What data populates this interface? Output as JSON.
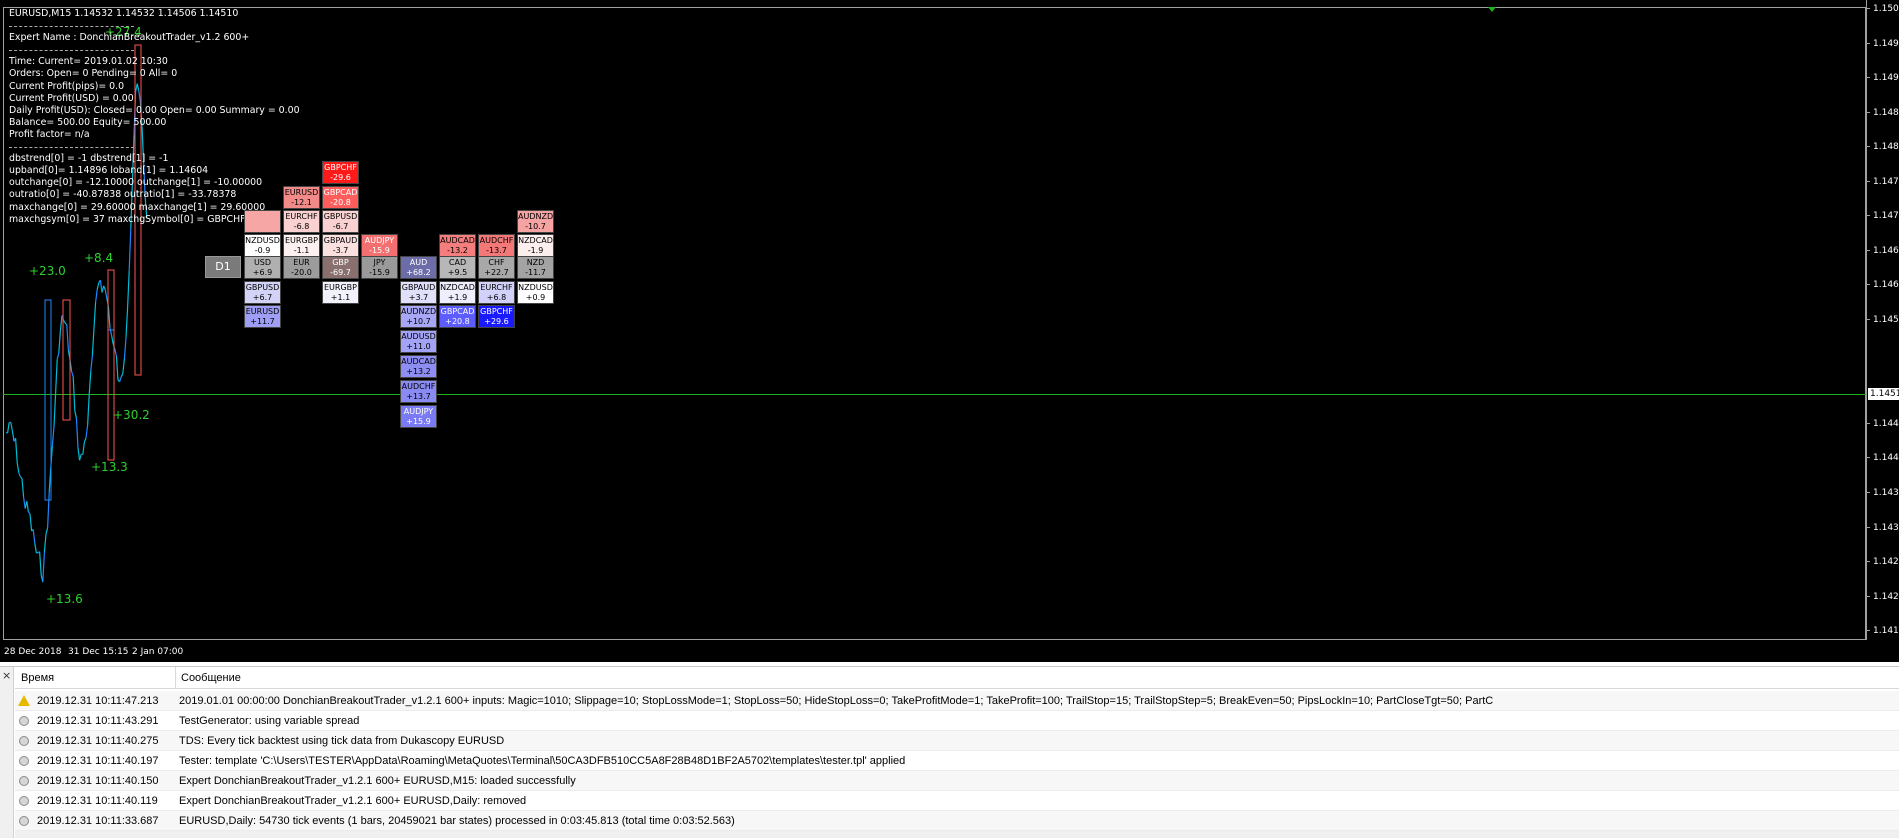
{
  "chart": {
    "symbol_header": "EURUSD,M15  1.14532 1.14532 1.14506 1.14510",
    "current_price": "1.1451",
    "price_labels": [
      "1.1500",
      "1.1495",
      "1.1490",
      "1.1485",
      "1.1480",
      "1.1475",
      "1.1470",
      "1.1465",
      "1.1460",
      "1.1455",
      "1.1445",
      "1.1440",
      "1.1435",
      "1.1430",
      "1.1425",
      "1.1420",
      "1.1415"
    ],
    "time_labels": [
      "28 Dec 2018",
      "31 Dec 15:15",
      "2 Jan 07:00"
    ],
    "signal_labels": [
      "+27.4",
      "+23.0",
      "+8.4",
      "+30.2",
      "+13.3",
      "+13.6"
    ],
    "colors": {
      "background": "#000000",
      "bull_candle": "#1e88ff",
      "bear_candle": "#00bcd4",
      "price_line": "#1db31d",
      "signal_text": "#2ed12e"
    }
  },
  "info_panel": {
    "expert_name": "Expert Name : DonchianBreakoutTrader_v1.2 600+",
    "time": "Time: Current= 2019.01.02 10:30",
    "orders": "Orders: Open= 0 Pending= 0 All= 0",
    "profit_pips": "Current Profit(pips)= 0.0",
    "profit_usd": "Current Profit(USD) = 0.00",
    "daily_profit": "Daily Profit(USD): Closed= 0.00 Open= 0.00 Summary = 0.00",
    "balance": "Balance= 500.00 Equity= 500.00",
    "profit_factor": "Profit factor= n/a",
    "dbstrend": "dbstrend[0] = -1 dbstrend[1] = -1",
    "upband": "upband[0]= 1.14896 loband[1] = 1.14604",
    "outchange": "outchange[0] = -12.10000 outchange[1] = -10.00000",
    "outratio": "outratio[0] = -40.87838 outratio[1] = -33.78378",
    "maxchange": "maxchange[0] = 29.60000 maxchange[1] = 29.60000",
    "maxchgsym": "maxchgsym[0] = 37 maxchgSymbol[0] = GBPCHF"
  },
  "heatmap": {
    "timeframe_button": "D1",
    "cells": [
      {
        "id": "gbpchf-top",
        "name": "GBPCHF",
        "value": "-29.6",
        "color": "#ff1a1a",
        "light": true
      },
      {
        "id": "eurusd-top",
        "name": "EURUSD",
        "value": "-12.1",
        "color": "#f28a8a",
        "light": false
      },
      {
        "id": "gbpcad-top",
        "name": "GBPCAD",
        "value": "-20.8",
        "color": "#ff5c5c",
        "light": true
      },
      {
        "id": "usd-empty",
        "name": "",
        "value": "",
        "color": "#f7a6a6",
        "light": false
      },
      {
        "id": "eurchf-top",
        "name": "EURCHF",
        "value": "-6.8",
        "color": "#f9d1d1",
        "light": false
      },
      {
        "id": "gbpusd-top",
        "name": "GBPUSD",
        "value": "-6.7",
        "color": "#f9d1d1",
        "light": false
      },
      {
        "id": "audnzd-top",
        "name": "AUDNZD",
        "value": "-10.7",
        "color": "#f6a3a3",
        "light": false
      },
      {
        "id": "nzdusd",
        "name": "NZDUSD",
        "value": "-0.9",
        "color": "#ffffff",
        "light": false
      },
      {
        "id": "eurgbp-top",
        "name": "EURGBP",
        "value": "-1.1",
        "color": "#fdf0f0",
        "light": false
      },
      {
        "id": "gbpaud-top",
        "name": "GBPAUD",
        "value": "-3.7",
        "color": "#fbe0e0",
        "light": false
      },
      {
        "id": "audjpy-top",
        "name": "AUDJPY",
        "value": "-15.9",
        "color": "#f47070",
        "light": true
      },
      {
        "id": "audcad-top",
        "name": "AUDCAD",
        "value": "-13.2",
        "color": "#f47d7d",
        "light": false
      },
      {
        "id": "audchf-top",
        "name": "AUDCHF",
        "value": "-13.7",
        "color": "#f47878",
        "light": false
      },
      {
        "id": "nzdcad-top",
        "name": "NZDCAD",
        "value": "-1.9",
        "color": "#fdeeee",
        "light": false
      },
      {
        "id": "usd",
        "name": "USD",
        "value": "+6.9",
        "color": "#b0b0b0",
        "light": false
      },
      {
        "id": "eur",
        "name": "EUR",
        "value": "-20.0",
        "color": "#9c9c9c",
        "light": false
      },
      {
        "id": "gbp",
        "name": "GBP",
        "value": "-69.7",
        "color": "#8a6f6f",
        "light": true
      },
      {
        "id": "jpy",
        "name": "JPY",
        "value": "-15.9",
        "color": "#9a9a9a",
        "light": false
      },
      {
        "id": "aud",
        "name": "AUD",
        "value": "+68.2",
        "color": "#6c6ca8",
        "light": true
      },
      {
        "id": "cad",
        "name": "CAD",
        "value": "+9.5",
        "color": "#b7b7b7",
        "light": false
      },
      {
        "id": "chf",
        "name": "CHF",
        "value": "+22.7",
        "color": "#a8a8a8",
        "light": false
      },
      {
        "id": "nzd",
        "name": "NZD",
        "value": "-11.7",
        "color": "#a3a3a3",
        "light": false
      },
      {
        "id": "gbpusd-bot",
        "name": "GBPUSD",
        "value": "+6.7",
        "color": "#d3d3f7",
        "light": false
      },
      {
        "id": "eurgbp-bot",
        "name": "EURGBP",
        "value": "+1.1",
        "color": "#f2f2fd",
        "light": false
      },
      {
        "id": "gbpaud-bot",
        "name": "GBPAUD",
        "value": "+3.7",
        "color": "#e0e0fb",
        "light": false
      },
      {
        "id": "nzdcad-bot",
        "name": "NZDCAD",
        "value": "+1.9",
        "color": "#eeeefd",
        "light": false
      },
      {
        "id": "eurchf-bot",
        "name": "EURCHF",
        "value": "+6.8",
        "color": "#d1d1f9",
        "light": false
      },
      {
        "id": "nzdusd-bot",
        "name": "NZDUSD",
        "value": "+0.9",
        "color": "#ffffff",
        "light": false
      },
      {
        "id": "eurusd-bot",
        "name": "EURUSD",
        "value": "+11.7",
        "color": "#9e9ef4",
        "light": false
      },
      {
        "id": "audnzd-bot",
        "name": "AUDNZD",
        "value": "+10.7",
        "color": "#a7a7f5",
        "light": false
      },
      {
        "id": "gbpcad-bot",
        "name": "GBPCAD",
        "value": "+20.8",
        "color": "#5c5cff",
        "light": true
      },
      {
        "id": "gbpchf-bot",
        "name": "GBPCHF",
        "value": "+29.6",
        "color": "#1a1aff",
        "light": true
      },
      {
        "id": "audusd",
        "name": "AUDUSD",
        "value": "+11.0",
        "color": "#a3a3f5",
        "light": false
      },
      {
        "id": "audcad-bot",
        "name": "AUDCAD",
        "value": "+13.2",
        "color": "#8d8df3",
        "light": false
      },
      {
        "id": "audchf-bot",
        "name": "AUDCHF",
        "value": "+13.7",
        "color": "#8a8af3",
        "light": false
      },
      {
        "id": "audjpy-bot",
        "name": "AUDJPY",
        "value": "+15.9",
        "color": "#7a7af4",
        "light": true
      }
    ]
  },
  "journal": {
    "close_glyph": "×",
    "columns": {
      "time": "Время",
      "message": "Сообщение"
    },
    "rows": [
      {
        "type": "warning",
        "time": "2019.12.31 10:11:47.213",
        "message": "2019.01.01 00:00:00  DonchianBreakoutTrader_v1.2.1 600+ inputs: Magic=1010; Slippage=10; StopLossMode=1; StopLoss=50; HideStopLoss=0; TakeProfitMode=1; TakeProfit=100; TrailStop=15; TrailStopStep=5; BreakEven=50; PipsLockIn=10; PartCloseTgt=50; PartC"
      },
      {
        "type": "info",
        "time": "2019.12.31 10:11:43.291",
        "message": "TestGenerator: using variable spread"
      },
      {
        "type": "info",
        "time": "2019.12.31 10:11:40.275",
        "message": "TDS: Every tick backtest using tick data from Dukascopy EURUSD"
      },
      {
        "type": "info",
        "time": "2019.12.31 10:11:40.197",
        "message": "Tester: template 'C:\\Users\\TESTER\\AppData\\Roaming\\MetaQuotes\\Terminal\\50CA3DFB510CC5A8F28B48D1BF2A5702\\templates\\tester.tpl' applied"
      },
      {
        "type": "info",
        "time": "2019.12.31 10:11:40.150",
        "message": "Expert DonchianBreakoutTrader_v1.2.1 600+ EURUSD,M15: loaded successfully"
      },
      {
        "type": "info",
        "time": "2019.12.31 10:11:40.119",
        "message": "Expert DonchianBreakoutTrader_v1.2.1 600+ EURUSD,Daily: removed"
      },
      {
        "type": "info",
        "time": "2019.12.31 10:11:33.687",
        "message": "EURUSD,Daily: 54730 tick events (1 bars, 20459021 bar states) processed in 0:03:45.813 (total time 0:03:52.563)"
      }
    ]
  }
}
